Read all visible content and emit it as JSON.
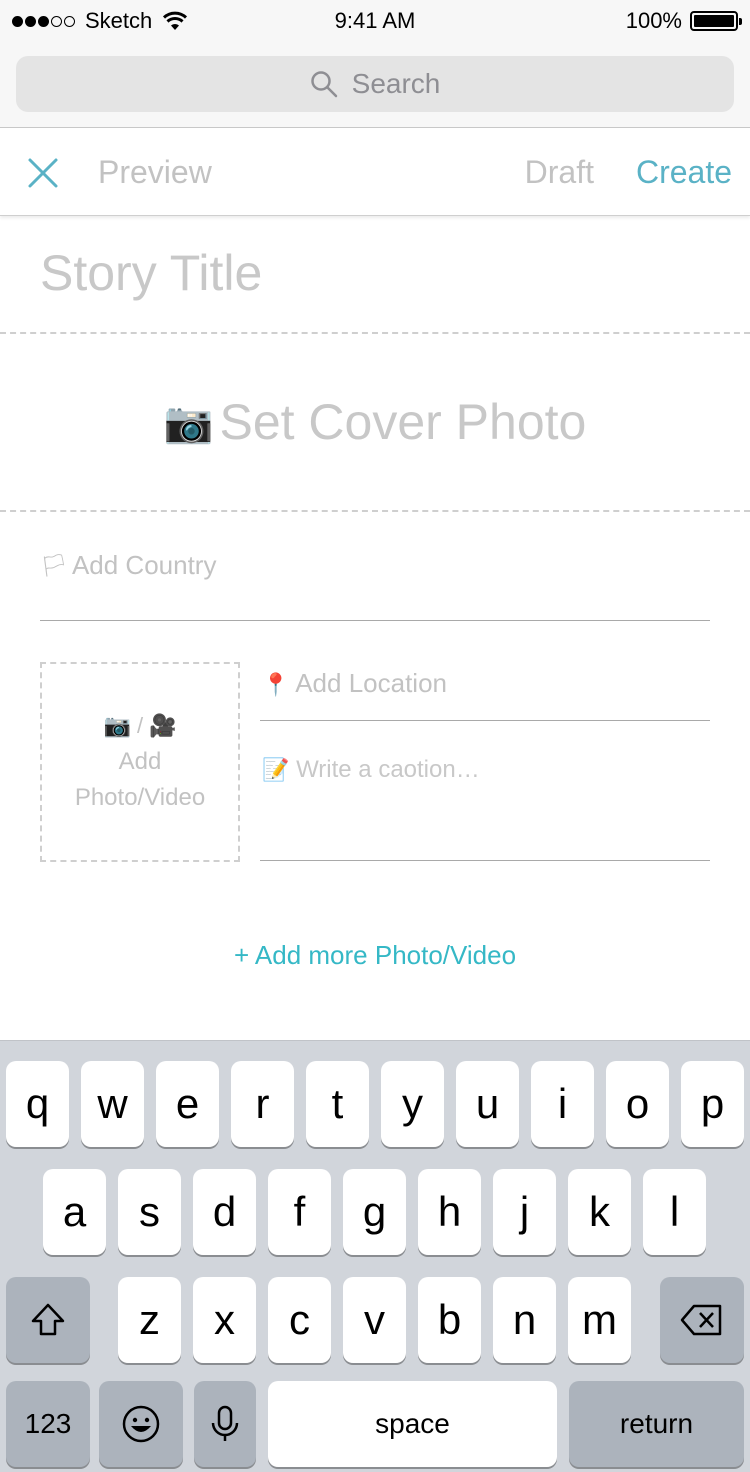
{
  "status_bar": {
    "carrier": "Sketch",
    "time": "9:41 AM",
    "battery": "100%"
  },
  "search": {
    "placeholder": "Search"
  },
  "nav": {
    "preview": "Preview",
    "draft": "Draft",
    "create": "Create",
    "accent_color": "#5ab2c6"
  },
  "form": {
    "title_placeholder": "Story Title",
    "cover_emoji": "📷",
    "cover_label": "Set Cover Photo",
    "country_emoji": "🏳",
    "country_placeholder": "Add Country",
    "media_icons": "📷 / 🎥",
    "media_label_line1": "Add",
    "media_label_line2": "Photo/Video",
    "location_emoji": "📍",
    "location_placeholder": "Add Location",
    "caption_emoji": "📝",
    "caption_placeholder": "Write a caotion…",
    "add_more": "+ Add more Photo/Video",
    "link_color": "#35b8c6"
  },
  "keyboard": {
    "row1": [
      "q",
      "w",
      "e",
      "r",
      "t",
      "y",
      "u",
      "i",
      "o",
      "p"
    ],
    "row2": [
      "a",
      "s",
      "d",
      "f",
      "g",
      "h",
      "j",
      "k",
      "l"
    ],
    "row3": [
      "z",
      "x",
      "c",
      "v",
      "b",
      "n",
      "m"
    ],
    "numbers": "123",
    "space": "space",
    "return": "return",
    "shift_icon": "shift-icon",
    "delete_icon": "backspace-icon",
    "emoji_icon": "emoji-icon",
    "mic_icon": "microphone-icon"
  }
}
